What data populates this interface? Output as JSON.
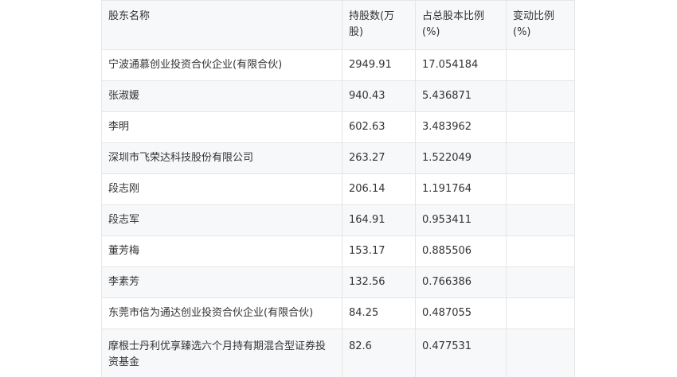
{
  "table": {
    "headers": [
      "股东名称",
      "持股数(万股)",
      "占总股本比例(%)",
      "变动比例(%)"
    ],
    "rows": [
      [
        "宁波通慕创业投资合伙企业(有限合伙)",
        "2949.91",
        "17.054184",
        ""
      ],
      [
        "张淑媛",
        "940.43",
        "5.436871",
        ""
      ],
      [
        "李明",
        "602.63",
        "3.483962",
        ""
      ],
      [
        "深圳市飞荣达科技股份有限公司",
        "263.27",
        "1.522049",
        ""
      ],
      [
        "段志刚",
        "206.14",
        "1.191764",
        ""
      ],
      [
        "段志军",
        "164.91",
        "0.953411",
        ""
      ],
      [
        "董芳梅",
        "153.17",
        "0.885506",
        ""
      ],
      [
        "李素芳",
        "132.56",
        "0.766386",
        ""
      ],
      [
        "东莞市信为通达创业投资合伙企业(有限合伙)",
        "84.25",
        "0.487055",
        ""
      ],
      [
        "摩根士丹利优享臻选六个月持有期混合型证券投资基金",
        "82.6",
        "0.477531",
        ""
      ]
    ]
  }
}
